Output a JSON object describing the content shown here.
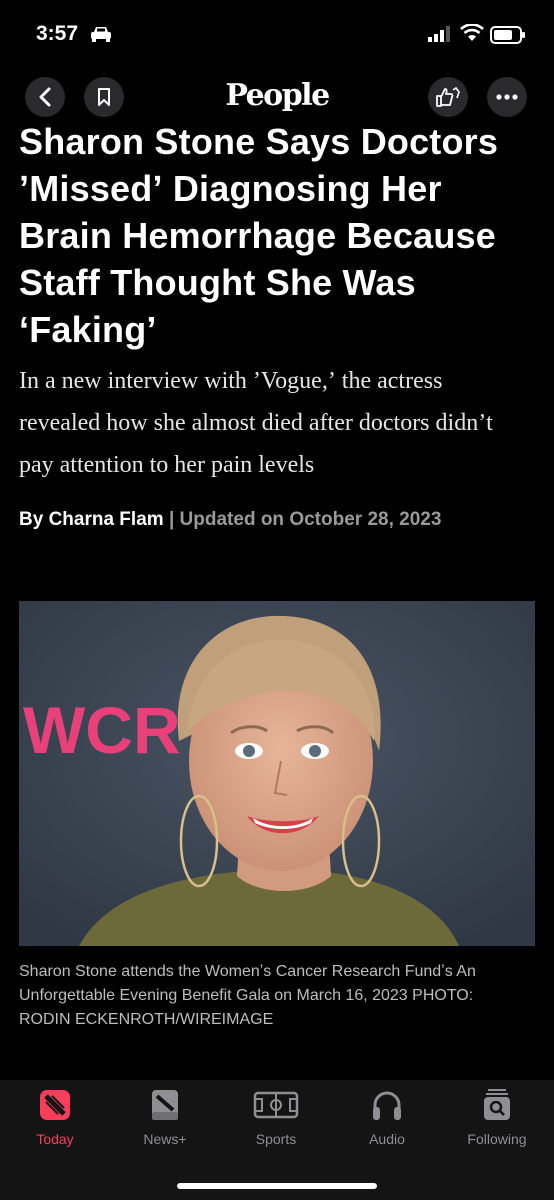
{
  "status": {
    "time": "3:57"
  },
  "nav": {
    "logo": "People"
  },
  "article": {
    "headline": "Sharon Stone Says Doctors ʼMissedʼ Diagnosing Her Brain Hemorrhage Because Staff Thought She Was ‘Faking’",
    "dek": "In a new interview with ʼVogue,ʼ the actress revealed how she almost died after doctors didnʼt pay attention to her pain levels",
    "author": "By Charna Flam",
    "separator": "|",
    "updated": "Updated on October 28, 2023",
    "photo_sign_text": "WCR",
    "caption": "Sharon Stone attends the Womenʼs Cancer Research Fundʼs An Unforgettable Evening Benefit Gala on March 16, 2023 PHOTO: RODIN ECKENROTH/WIREIMAGE"
  },
  "tabs": [
    {
      "label": "Today",
      "icon": "apple-news-icon",
      "active": true
    },
    {
      "label": "News+",
      "icon": "news-plus-icon",
      "active": false
    },
    {
      "label": "Sports",
      "icon": "sports-icon",
      "active": false
    },
    {
      "label": "Audio",
      "icon": "headphones-icon",
      "active": false
    },
    {
      "label": "Following",
      "icon": "following-icon",
      "active": false
    }
  ],
  "colors": {
    "accent": "#fb3d5c",
    "background": "#000000",
    "tabbar": "#141414"
  }
}
